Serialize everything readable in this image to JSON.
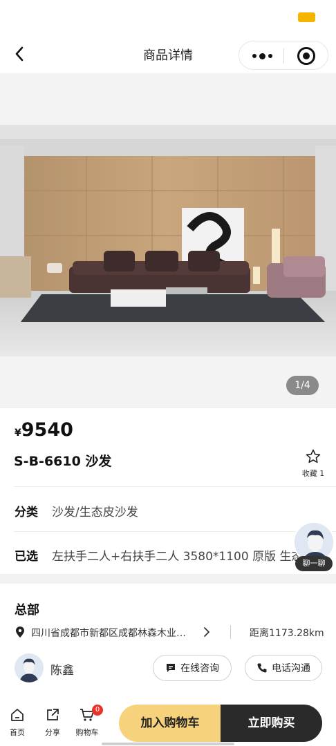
{
  "nav": {
    "title": "商品详情",
    "back_icon": "chevron-left-icon",
    "more_icon": "more-dots-icon",
    "close_icon": "target-circle-icon"
  },
  "gallery": {
    "page_indicator": "1/4"
  },
  "product": {
    "currency": "¥",
    "price": "9540",
    "name": "S-B-6610 沙发",
    "favorite_label": "收藏 1"
  },
  "specs": {
    "category_label": "分类",
    "category_value": "沙发/生态皮沙发",
    "selected_label": "已选",
    "selected_value": "左扶手二人+右扶手二人 3580*1100 原版 生态"
  },
  "chat": {
    "label": "聊一聊"
  },
  "store": {
    "title": "总部",
    "address": "四川省成都市新都区成都林森木业…",
    "distance": "距离1173.28km",
    "agent_name": "陈鑫",
    "consult_label": "在线咨询",
    "call_label": "电话沟通"
  },
  "bottom_bar": {
    "home_label": "首页",
    "share_label": "分享",
    "cart_label": "购物车",
    "cart_count": "0",
    "add_to_cart": "加入购物车",
    "buy_now": "立即购买"
  },
  "colors": {
    "accent_yellow": "#f7d27c",
    "dark_button": "#2a2a2a",
    "badge_red": "#e8332b",
    "status_battery": "#f5b400"
  }
}
